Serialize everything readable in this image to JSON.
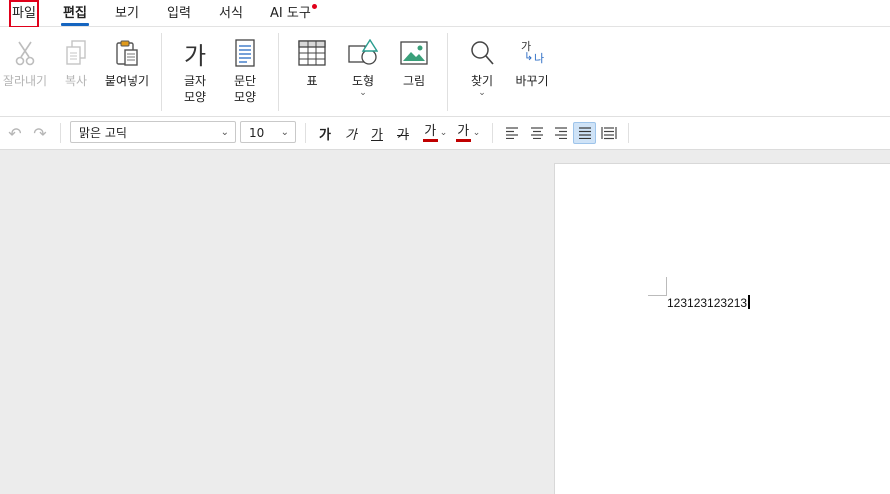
{
  "menu": {
    "tabs": [
      {
        "label": "파일"
      },
      {
        "label": "편집"
      },
      {
        "label": "보기"
      },
      {
        "label": "입력"
      },
      {
        "label": "서식"
      },
      {
        "label": "AI 도구"
      }
    ]
  },
  "ribbon": {
    "cut": "잘라내기",
    "copy": "복사",
    "paste": "붙여넣기",
    "char_shape_icon": "가",
    "char_shape": "글자\n모양",
    "para_shape": "문단\n모양",
    "table": "표",
    "shape": "도형",
    "picture": "그림",
    "find": "찾기",
    "replace": "바꾸기",
    "replace_icon_top": "가",
    "replace_icon_bottom": "나"
  },
  "format_bar": {
    "font": "맑은 고딕",
    "size": "10",
    "bold": "가",
    "italic": "가",
    "underline": "가",
    "strike": "가",
    "font_color": "가",
    "highlight": "가"
  },
  "document": {
    "text": "123123123213"
  },
  "colors": {
    "accent": "#1565c0",
    "highlight_red": "#e0001a",
    "font_color_bar": "#c00000"
  }
}
